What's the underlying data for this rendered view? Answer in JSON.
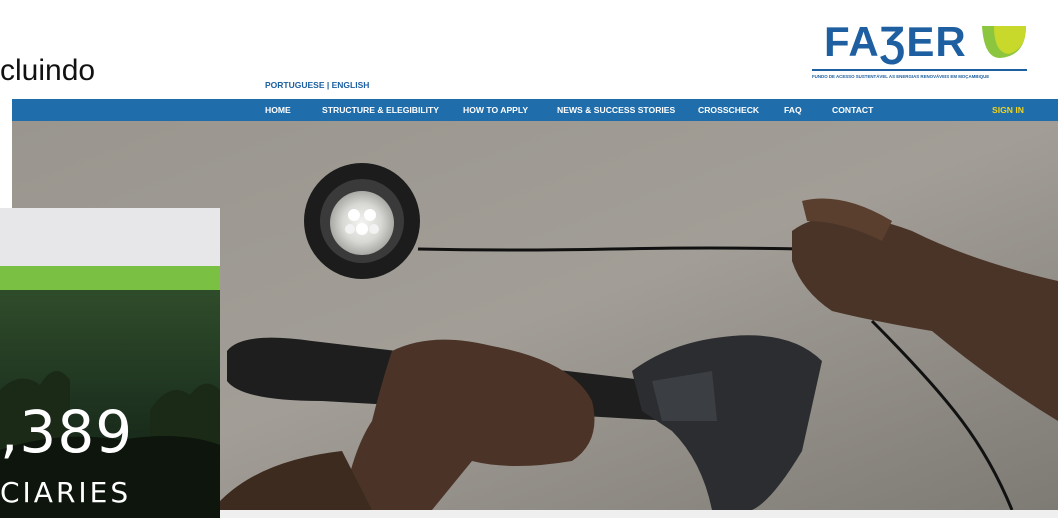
{
  "slide": {
    "partial_text": "cluindo"
  },
  "logo": {
    "wordmark": "FAƷER",
    "tagline": "FUNDO DE ACESSO SUSTENTÁVEL AS ENERGIAS RENOVÁVEIS EM MOÇAMBIQUE"
  },
  "language": {
    "label": "PORTUGUESE | ENGLISH"
  },
  "nav": {
    "items": [
      {
        "label": "HOME"
      },
      {
        "label": "STRUCTURE & ELEGIBILITY"
      },
      {
        "label": "HOW TO APPLY"
      },
      {
        "label": "NEWS & SUCCESS STORIES"
      },
      {
        "label": "CROSSCHECK"
      },
      {
        "label": "FAQ"
      },
      {
        "label": "CONTACT"
      }
    ],
    "sign_in": "SIGN IN"
  },
  "stats_card": {
    "number": ",389",
    "label": "CIARIES"
  },
  "colors": {
    "brand_blue": "#1d5fa0",
    "nav_blue": "#1f6daa",
    "accent_green": "#7ac143",
    "sign_in_yellow": "#f2d41a"
  }
}
